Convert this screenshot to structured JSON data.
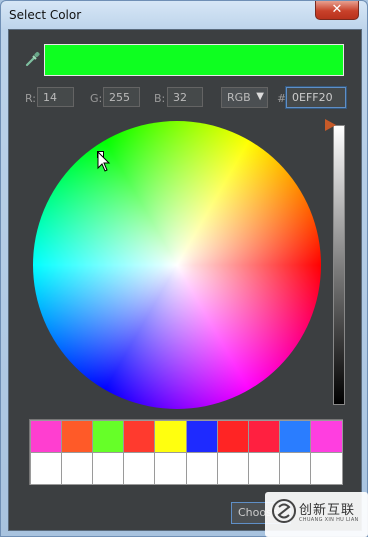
{
  "window": {
    "title": "Select Color",
    "close_glyph": "✕"
  },
  "preview": {
    "color": "#0EFF20"
  },
  "fields": {
    "r_label": "R:",
    "r_value": "14",
    "g_label": "G:",
    "g_value": "255",
    "b_label": "B:",
    "b_value": "32",
    "mode": "RGB",
    "mode_arrow": "▼",
    "hash": "#",
    "hex_value": "0EFF20"
  },
  "swatches": {
    "recent": [
      "#ff3ed0",
      "#ff5a28",
      "#66ff28",
      "#ff3a2e",
      "#ffff0f",
      "#1e2aff",
      "#ff2424",
      "#ff2040",
      "#2a7dff",
      "#ff3ee0"
    ],
    "empty": [
      "#ffffff",
      "#ffffff",
      "#ffffff",
      "#ffffff",
      "#ffffff",
      "#ffffff",
      "#ffffff",
      "#ffffff",
      "#ffffff",
      "#ffffff"
    ]
  },
  "buttons": {
    "choose": "Choose"
  },
  "watermark": {
    "cn": "创新互联",
    "en": "CHUANG XIN HU LIAN"
  },
  "icons": {
    "eyedropper": "eyedropper-icon",
    "close": "close-icon",
    "cursor": "mouse-cursor-icon"
  },
  "colors": {
    "panel_bg": "#3c3f41",
    "field_border": "#646464",
    "accent": "#5f8fc7",
    "slider_thumb": "#c75a28"
  }
}
